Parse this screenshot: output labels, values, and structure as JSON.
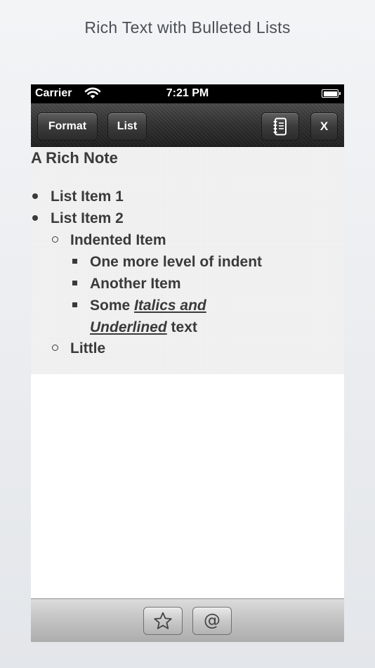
{
  "caption": "Rich Text with Bulleted Lists",
  "status_bar": {
    "carrier": "Carrier",
    "time": "7:21 PM"
  },
  "toolbar": {
    "format_label": "Format",
    "list_label": "List",
    "notebook_icon": "notebook-icon",
    "close_label": "X"
  },
  "note": {
    "title": "A Rich Note",
    "items": [
      {
        "level": 1,
        "bullet": "disc",
        "text": "List Item 1"
      },
      {
        "level": 1,
        "bullet": "disc",
        "text": "List Item 2"
      },
      {
        "level": 2,
        "bullet": "circle",
        "text": "Indented Item"
      },
      {
        "level": 3,
        "bullet": "square",
        "text": "One more level of indent"
      },
      {
        "level": 3,
        "bullet": "square",
        "text": "Another Item"
      },
      {
        "level": 3,
        "bullet": "square",
        "pre": "Some ",
        "emph1": "Italics and",
        "emph2": "Underlined",
        "post": " text"
      },
      {
        "level": 2,
        "bullet": "circle",
        "text": "Little"
      }
    ]
  },
  "bottom_bar": {
    "favorite_icon": "star-icon",
    "mention_icon": "at-icon"
  }
}
